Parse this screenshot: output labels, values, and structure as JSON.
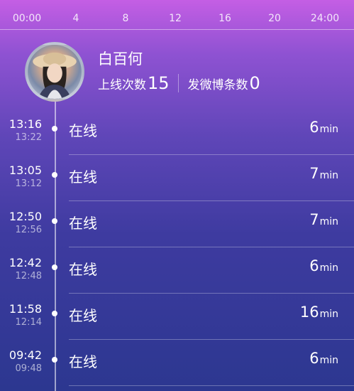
{
  "hour_axis": [
    "00:00",
    "4",
    "8",
    "12",
    "16",
    "20",
    "24:00"
  ],
  "user": {
    "name": "白百何",
    "online_label": "上线次数",
    "online_count": "15",
    "weibo_label": "发微博条数",
    "weibo_count": "0"
  },
  "sessions": [
    {
      "start": "13:16",
      "end": "13:22",
      "status": "在线",
      "duration": "6",
      "unit": "min"
    },
    {
      "start": "13:05",
      "end": "13:12",
      "status": "在线",
      "duration": "7",
      "unit": "min"
    },
    {
      "start": "12:50",
      "end": "12:56",
      "status": "在线",
      "duration": "7",
      "unit": "min"
    },
    {
      "start": "12:42",
      "end": "12:48",
      "status": "在线",
      "duration": "6",
      "unit": "min"
    },
    {
      "start": "11:58",
      "end": "12:14",
      "status": "在线",
      "duration": "16",
      "unit": "min"
    },
    {
      "start": "09:42",
      "end": "09:48",
      "status": "在线",
      "duration": "6",
      "unit": "min"
    }
  ]
}
